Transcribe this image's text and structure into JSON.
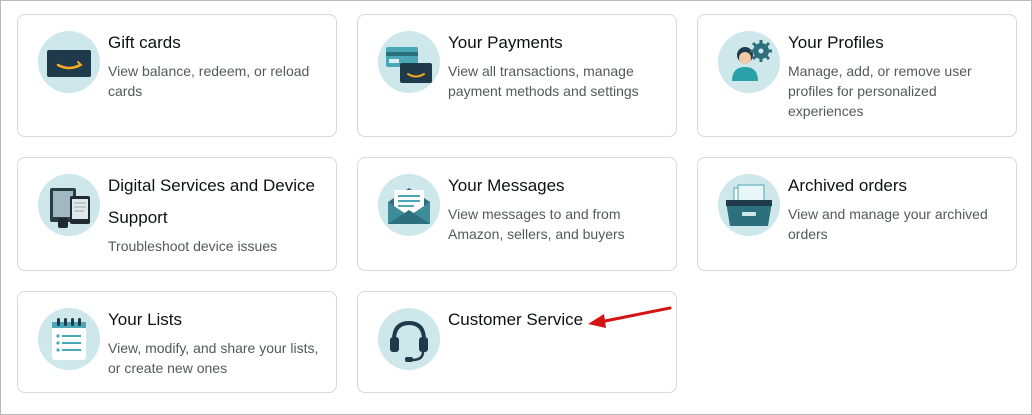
{
  "cards": [
    {
      "title": "Gift cards",
      "desc": "View balance, redeem, or reload cards",
      "icon": "gift-card-icon"
    },
    {
      "title": "Your Payments",
      "desc": "View all transactions, manage payment methods and settings",
      "icon": "payments-icon"
    },
    {
      "title": "Your Profiles",
      "desc": "Manage, add, or remove user profiles for personalized experiences",
      "icon": "profiles-icon"
    },
    {
      "title": "Digital Services and Device Support",
      "desc": "Troubleshoot device issues",
      "icon": "devices-icon"
    },
    {
      "title": "Your Messages",
      "desc": "View messages to and from Amazon, sellers, and buyers",
      "icon": "messages-icon"
    },
    {
      "title": "Archived orders",
      "desc": "View and manage your archived orders",
      "icon": "archive-box-icon"
    },
    {
      "title": "Your Lists",
      "desc": "View, modify, and share your lists, or create new ones",
      "icon": "notepad-list-icon"
    },
    {
      "title": "Customer Service",
      "desc": "",
      "icon": "headset-icon"
    }
  ],
  "colors": {
    "icon_bg": "#cde7ea",
    "title_text": "#0f1111",
    "desc_text": "#565959",
    "card_border": "#d5d9d9",
    "annotation_arrow": "#d41414"
  }
}
